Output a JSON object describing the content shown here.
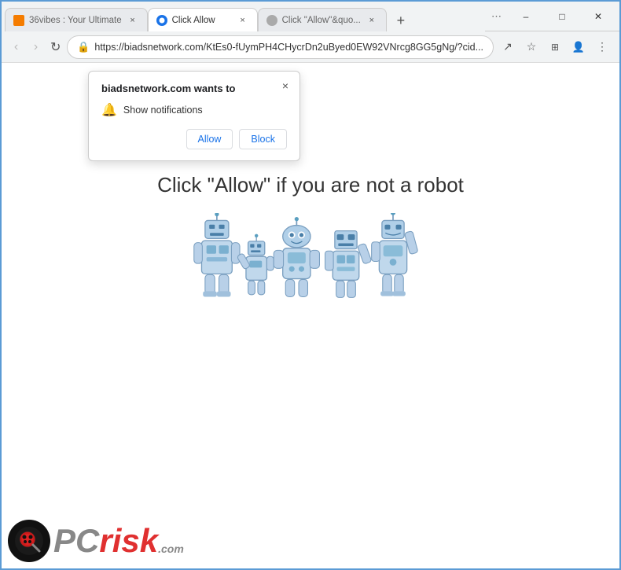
{
  "browser": {
    "tabs": [
      {
        "id": "tab1",
        "title": "36vibes : Your Ultimate",
        "active": false,
        "favicon_color": "#f57c00"
      },
      {
        "id": "tab2",
        "title": "Click Allow",
        "active": true,
        "favicon_color": "#1a73e8"
      },
      {
        "id": "tab3",
        "title": "Click \"Allow\"&quo...",
        "active": false,
        "favicon_color": "#aaa"
      }
    ],
    "address_bar": {
      "url": "https://biadsnetwork.com/KtEs0-fUymPH4CHycrDn2uByed0EW92VNrcg8GG5gNg/?cid..."
    },
    "new_tab_label": "+"
  },
  "window_controls": {
    "minimize": "–",
    "maximize": "□",
    "close": "✕"
  },
  "nav_buttons": {
    "back": "‹",
    "forward": "›",
    "refresh": "↻"
  },
  "nav_actions": {
    "bookmark_star": "☆",
    "extensions": "⊞",
    "profile": "👤",
    "menu": "⋮",
    "share": "↗"
  },
  "notification_popup": {
    "title": "biadsnetwork.com wants to",
    "permission_text": "Show notifications",
    "allow_label": "Allow",
    "block_label": "Block",
    "close_symbol": "×"
  },
  "page": {
    "main_text": "Click \"Allow\"   if you are not   a robot"
  },
  "pcrisk": {
    "text": "PC",
    "suffix": "risk",
    "dot_com": ".com"
  }
}
